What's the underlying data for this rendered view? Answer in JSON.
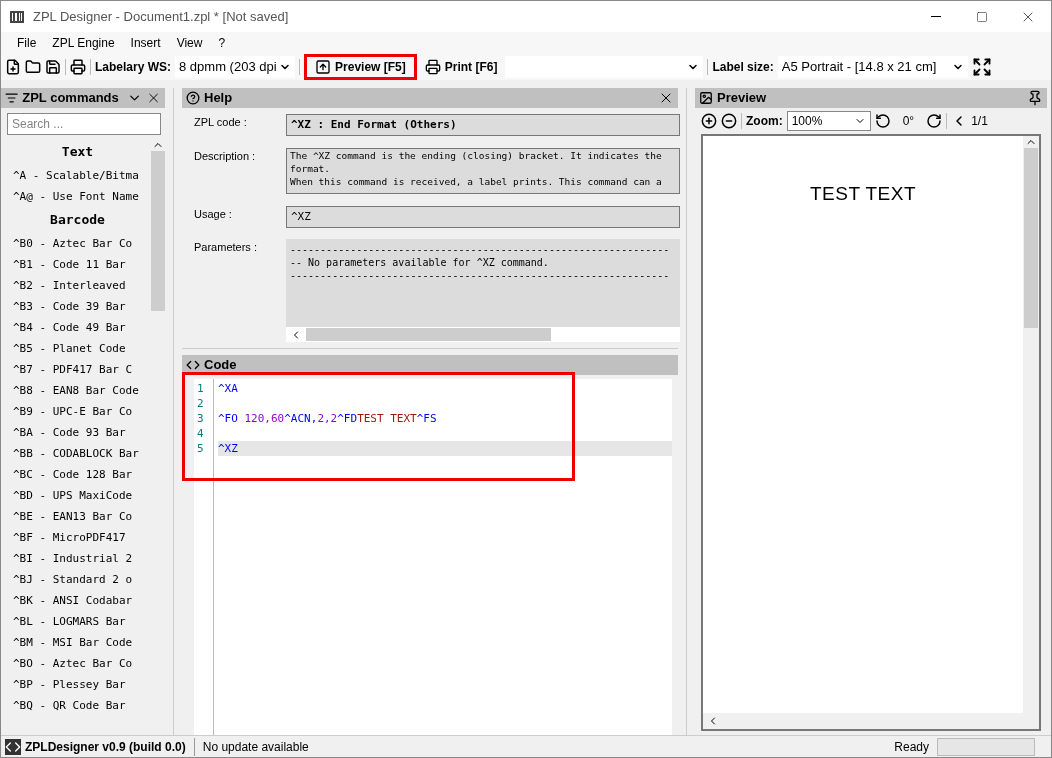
{
  "window": {
    "title": "ZPL Designer - Document1.zpl * [Not saved]"
  },
  "menu": [
    "File",
    "ZPL Engine",
    "Insert",
    "View",
    "?"
  ],
  "toolbar": {
    "printer_label": "Labelary WS:",
    "printer_value": "8 dpmm (203 dpi",
    "preview_button": {
      "label": "Preview [F5]",
      "highlighted": true
    },
    "print_button": "Print [F6]",
    "size_label": "Label size:",
    "size_value": "A5 Portrait - [14.8 x 21 cm]"
  },
  "commands_panel": {
    "title": "ZPL commands",
    "search": {
      "placeholder": "Search ..."
    },
    "groups": [
      {
        "name": "Text",
        "items": [
          "^A - Scalable/Bitma",
          "^A@ - Use Font Name"
        ]
      },
      {
        "name": "Barcode",
        "items": [
          "^B0 - Aztec Bar Co",
          "^B1 - Code 11 Bar",
          "^B2 - Interleaved",
          "^B3 - Code 39 Bar",
          "^B4 - Code 49 Bar",
          "^B5 - Planet Code",
          "^B7 - PDF417 Bar C",
          "^B8 - EAN8 Bar Code",
          "^B9 - UPC-E Bar Co",
          "^BA - Code 93 Bar",
          "^BB - CODABLOCK Bar",
          "^BC - Code 128 Bar",
          "^BD - UPS MaxiCode",
          "^BE - EAN13 Bar Co",
          "^BF - MicroPDF417",
          "^BI - Industrial 2",
          "^BJ - Standard 2 o",
          "^BK - ANSI Codabar",
          "^BL - LOGMARS Bar",
          "^BM - MSI Bar Code",
          "^BO - Aztec Bar Co",
          "^BP - Plessey Bar",
          "^BQ - QR Code Bar"
        ]
      }
    ]
  },
  "help_panel": {
    "title": "Help",
    "zpl_code_label": "ZPL code :",
    "zpl_code": "^XZ : End Format (Others)",
    "description_label": "Description :",
    "description": [
      "The ^XZ command is the ending (closing) bracket. It indicates the",
      "format.",
      "When this command is received, a label prints. This command can a"
    ],
    "usage_label": "Usage :",
    "usage": "^XZ",
    "parameters_label": "Parameters :",
    "parameters": [
      "---------------------------------------------------------------",
      "-- No parameters available for ^XZ command.",
      "---------------------------------------------------------------"
    ]
  },
  "code_panel": {
    "title": "Code",
    "highlighted": true,
    "lines": [
      {
        "number": "1",
        "current": false,
        "tokens": [
          {
            "kind": "command",
            "text": "^XA"
          }
        ]
      },
      {
        "number": "2",
        "current": false
      },
      {
        "number": "3",
        "current": false,
        "tokens": [
          {
            "kind": "command",
            "text": "^FO "
          },
          {
            "kind": "number",
            "text": "120,60"
          },
          {
            "kind": "command",
            "text": "^ACN,"
          },
          {
            "kind": "number",
            "text": "2,2"
          },
          {
            "kind": "command",
            "text": "^FD"
          },
          {
            "kind": "string",
            "text": "TEST TEXT"
          },
          {
            "kind": "command",
            "text": "^FS"
          }
        ]
      },
      {
        "number": "4",
        "current": false
      },
      {
        "number": "5",
        "current": true,
        "tokens": [
          {
            "kind": "command",
            "text": "^XZ"
          }
        ]
      }
    ]
  },
  "preview_panel": {
    "title": "Preview",
    "zoom_label": "Zoom:",
    "zoom_value": "100%",
    "rotation": "0°",
    "page": "1/1",
    "label_text": "TEST TEXT"
  },
  "status_bar": {
    "version": "ZPLDesigner v0.9 (build 0.0)",
    "update": "No update available",
    "state": "Ready"
  }
}
